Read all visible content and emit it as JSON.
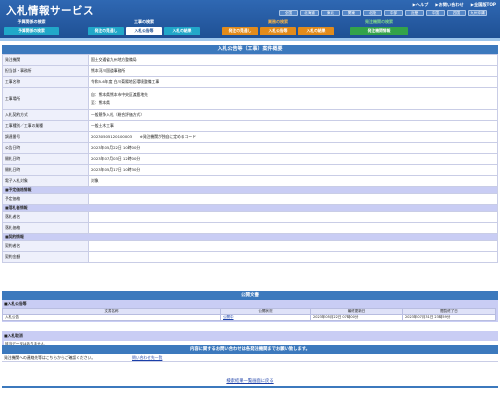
{
  "header": {
    "title": "入札情報サービス",
    "links": [
      "▶ヘルプ",
      "▶お問い合わせ",
      "▶全国版TOP"
    ],
    "regions": [
      "全国",
      "北海道",
      "東北",
      "関東",
      "北陸",
      "中部",
      "近畿",
      "中国",
      "四国",
      "九州沖縄"
    ]
  },
  "nav": {
    "groups": [
      {
        "label": "予算関係の検索",
        "tabs": [
          {
            "label": "予算関係の検索"
          }
        ]
      },
      {
        "label": "工事の検索",
        "tabs": [
          {
            "label": "発注の見通し"
          },
          {
            "label": "入札公告等"
          },
          {
            "label": "入札の結果"
          }
        ]
      },
      {
        "label": "業務の検索",
        "tabs": [
          {
            "label": "発注の見通し"
          },
          {
            "label": "入札公告等"
          },
          {
            "label": "入札の結果"
          }
        ]
      },
      {
        "label": "発注機関の検索",
        "tabs": [
          {
            "label": "発注機関情報"
          }
        ]
      }
    ]
  },
  "detail": {
    "title": "入札公告等（工事）案件概要",
    "rows": [
      {
        "label": "発注機関",
        "value": "国土交通省九州地方整備局"
      },
      {
        "label": "担当部・事務所",
        "value": "熊本河川国道事務所"
      },
      {
        "label": "工事名称",
        "value": "令和5-6年度 白川菊陽地区環境整備工事"
      },
      {
        "label": "工事場所",
        "value": "自：熊本県熊本市中央区渡鹿地先",
        "value2": "至：熊本県"
      },
      {
        "label": "入札契約方式",
        "value": "一般競争入札（総合評価方式）"
      },
      {
        "label": "工事種別／工事の業種",
        "value": "一般土木工事"
      },
      {
        "label": "調達番号",
        "value": "20230505120100003　　※発注機関が独自に定めるコード"
      },
      {
        "label": "公告日時",
        "value": "2023年05月22日 10時00分"
      },
      {
        "label": "開札日時",
        "value": "2023年07月03日 12時00分"
      },
      {
        "label": "開札日時",
        "value": "2023年05月17日 10時30分"
      },
      {
        "label": "電子入札対象",
        "value": "対象"
      }
    ],
    "sections": [
      {
        "title": "■予定価格情報",
        "rows": [
          {
            "label": "予定価格",
            "value": ""
          }
        ]
      },
      {
        "title": "■落札者情報",
        "rows": [
          {
            "label": "落札者名",
            "value": ""
          },
          {
            "label": "落札価格",
            "value": ""
          }
        ]
      },
      {
        "title": "■契約情報",
        "rows": [
          {
            "label": "契約者名",
            "value": ""
          },
          {
            "label": "契約金額",
            "value": ""
          }
        ]
      }
    ]
  },
  "public_docs": {
    "title": "公開文書",
    "subtitle": "■入札公告等",
    "columns": [
      "文書名称",
      "公開状況",
      "最終更新日",
      "閲覧終了日"
    ],
    "rows": [
      {
        "name": "入札公告",
        "status": "公開中",
        "updated": "2023年05月22日 07時00分",
        "end": "2023年07月31日 23時59分"
      }
    ]
  },
  "cancel": {
    "subtitle": "■入札取消",
    "nodata": "該当データはありません"
  },
  "contact": {
    "title": "内容に関するお問い合わせは各発注機関までお願い致します。",
    "text": "発注機関への連絡先等はこちらからご確認ください。",
    "link": "問い合わせ先一覧"
  },
  "footer": {
    "back_link": "検索結果一覧画面に戻る"
  },
  "colors": {
    "header_blue": "#1e4f93",
    "section_purple": "#c9cdf4",
    "tab_cyan": "#21a8c9",
    "tab_orange": "#e28b1b",
    "tab_green": "#33a34a"
  }
}
